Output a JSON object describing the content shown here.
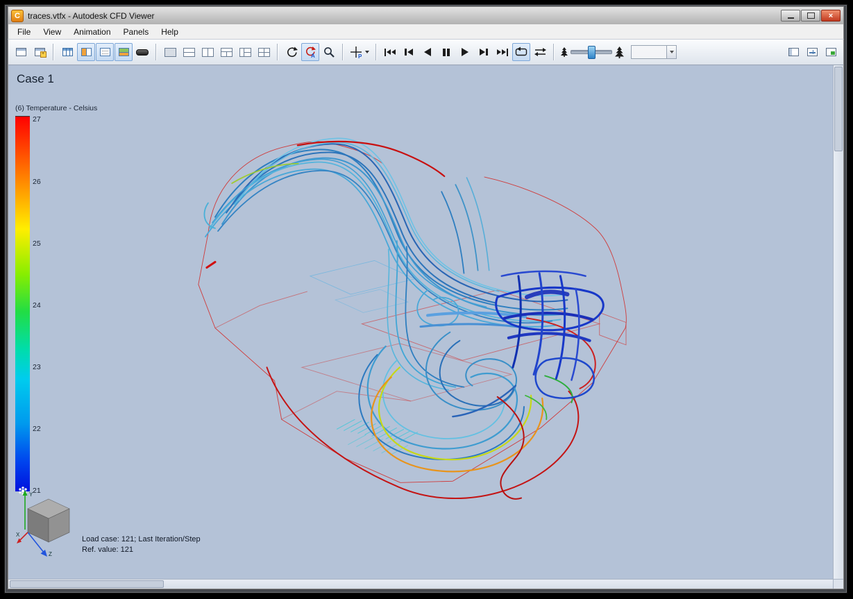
{
  "window": {
    "logo_letter": "C",
    "title": "traces.vtfx - Autodesk CFD Viewer",
    "close_glyph": "×"
  },
  "menu": {
    "items": [
      "File",
      "View",
      "Animation",
      "Panels",
      "Help"
    ]
  },
  "toolbar": {
    "icon_names": [
      "open-viewer",
      "add-viewer",
      "table",
      "split-pane-view",
      "frame-view",
      "case-view",
      "hide-bar",
      "layout-single",
      "layout-hsplit",
      "layout-vsplit",
      "layout-top-split",
      "layout-left-split",
      "layout-quad",
      "rotate",
      "rotate-animate",
      "zoom",
      "probe",
      "skip-start",
      "step-back",
      "play-reverse",
      "pause",
      "play-forward",
      "step-forward",
      "skip-end",
      "loop-repeat",
      "loop-bounce",
      "speed-slow",
      "speed-slider",
      "speed-fast",
      "frame-combo",
      "pane-left",
      "pane-add",
      "pane-new"
    ],
    "rotate_animate_label": "A",
    "probe_label": "P",
    "frame_combo_value": ""
  },
  "viewport": {
    "case_label": "Case 1",
    "legend": {
      "title": "(6) Temperature - Celsius",
      "ticks": [
        "27",
        "26",
        "25",
        "24",
        "23",
        "22",
        "21"
      ]
    },
    "status_line1": "Load case: 121; Last Iteration/Step",
    "status_line2": "Ref. value: 121",
    "axes": {
      "x": "X",
      "y": "Y",
      "z": "Z"
    }
  },
  "colors": {
    "viewport_bg": "#b4c2d7",
    "wireframe_red": "#d42420",
    "legend_top": "#ff0000",
    "legend_bottom": "#0011dd",
    "stream_blue": "#3b8fc4",
    "cluster_blue": "#1b2fb8",
    "accent_orange": "#e8941c",
    "accent_yellow": "#c6d818"
  }
}
